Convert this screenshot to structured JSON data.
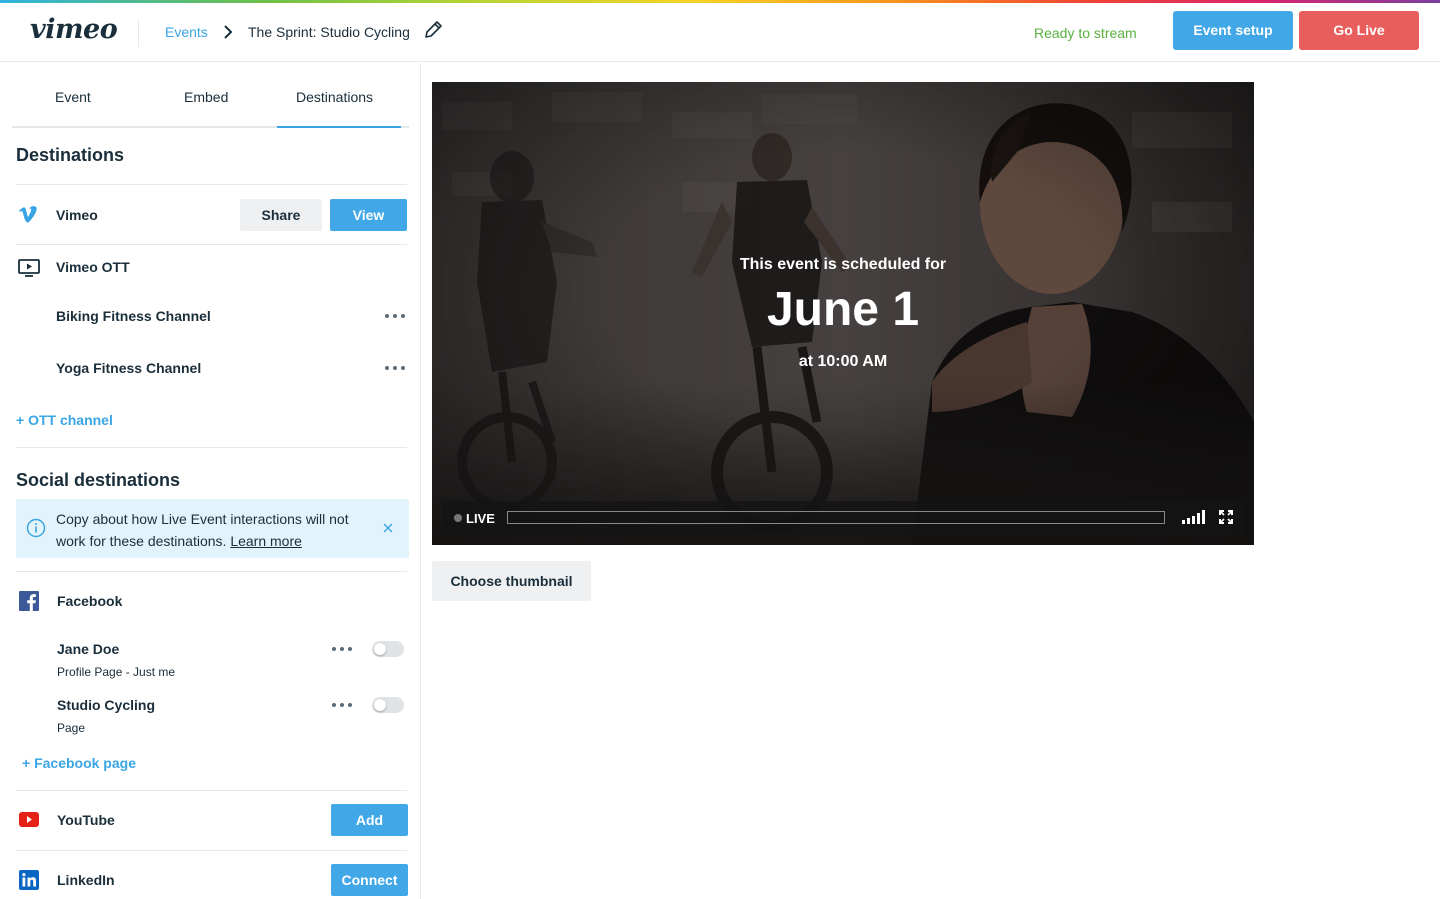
{
  "header": {
    "logo": "vimeo",
    "breadcrumb_root": "Events",
    "event_title": "The Sprint: Studio Cycling",
    "status": "Ready to stream",
    "event_setup_label": "Event setup",
    "go_live_label": "Go Live"
  },
  "tabs": [
    "Event",
    "Embed",
    "Destinations"
  ],
  "active_tab": "Destinations",
  "destinations": {
    "title": "Destinations",
    "vimeo": {
      "label": "Vimeo",
      "share_label": "Share",
      "view_label": "View"
    },
    "ott": {
      "label": "Vimeo OTT",
      "channels": [
        "Biking Fitness Channel",
        "Yoga Fitness Channel"
      ],
      "add_label": "+ OTT channel"
    }
  },
  "social": {
    "title": "Social destinations",
    "notice": "Copy about how Live Event interactions will not work for these destinations.",
    "notice_link": "Learn more",
    "facebook": {
      "label": "Facebook",
      "accounts": [
        {
          "name": "Jane Doe",
          "sub": "Profile Page - Just me",
          "enabled": false
        },
        {
          "name": "Studio Cycling",
          "sub": "Page",
          "enabled": false
        }
      ],
      "add_label": "+ Facebook page"
    },
    "youtube": {
      "label": "YouTube",
      "action": "Add"
    },
    "linkedin": {
      "label": "LinkedIn",
      "action": "Connect"
    }
  },
  "player": {
    "scheduled_text": "This event is scheduled for",
    "date": "June 1",
    "time": "at 10:00 AM",
    "live_label": "LIVE"
  },
  "choose_thumbnail_label": "Choose thumbnail",
  "colors": {
    "accent": "#42a7e6",
    "go_live": "#e85e5c",
    "ready": "#58b13f",
    "facebook": "#3b5998",
    "youtube": "#e62117",
    "linkedin": "#0a66c2"
  },
  "icons": [
    "vimeo-icon",
    "tv-play-icon",
    "facebook-icon",
    "youtube-icon",
    "linkedin-icon",
    "info-icon",
    "close-icon",
    "pencil-icon",
    "chevron-right-icon",
    "more-icon",
    "volume-icon",
    "fullscreen-icon"
  ]
}
